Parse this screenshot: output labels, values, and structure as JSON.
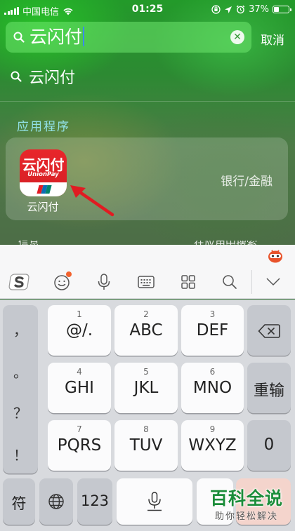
{
  "status_bar": {
    "carrier": "中国电信",
    "time": "01:25",
    "battery_text": "37%",
    "battery_level": 0.37
  },
  "search": {
    "query": "云闪付",
    "cancel_label": "取消"
  },
  "suggestion": {
    "text": "云闪付"
  },
  "section": {
    "title": "应用程序"
  },
  "app_result": {
    "name": "云闪付",
    "category": "银行/金融",
    "icon_logo_cn": "云闪付",
    "icon_logo_en": "UnionPay",
    "stripe_colors": [
      "#e21b24",
      "#0a6db5",
      "#00836c"
    ]
  },
  "partial_row": {
    "left": "信息",
    "right": "在应用中搜索"
  },
  "keyboard": {
    "punctuation": [
      "，",
      "。",
      "？",
      "！"
    ],
    "rows": [
      [
        {
          "num": "1",
          "label": "@/."
        },
        {
          "num": "2",
          "label": "ABC"
        },
        {
          "num": "3",
          "label": "DEF"
        }
      ],
      [
        {
          "num": "4",
          "label": "GHI"
        },
        {
          "num": "5",
          "label": "JKL"
        },
        {
          "num": "6",
          "label": "MNO"
        }
      ],
      [
        {
          "num": "7",
          "label": "PQRS"
        },
        {
          "num": "8",
          "label": "TUV"
        },
        {
          "num": "9",
          "label": "WXYZ"
        }
      ]
    ],
    "retype_label": "重输",
    "zero_label": "0",
    "symbol_label": "符",
    "number_label": "123"
  },
  "watermark": {
    "title": "百科全说",
    "subtitle": "助你轻松解决"
  },
  "colors": {
    "accent_red": "#d41f24",
    "arrow_red": "#e11b22",
    "watermark_green": "#1b8d3a"
  }
}
